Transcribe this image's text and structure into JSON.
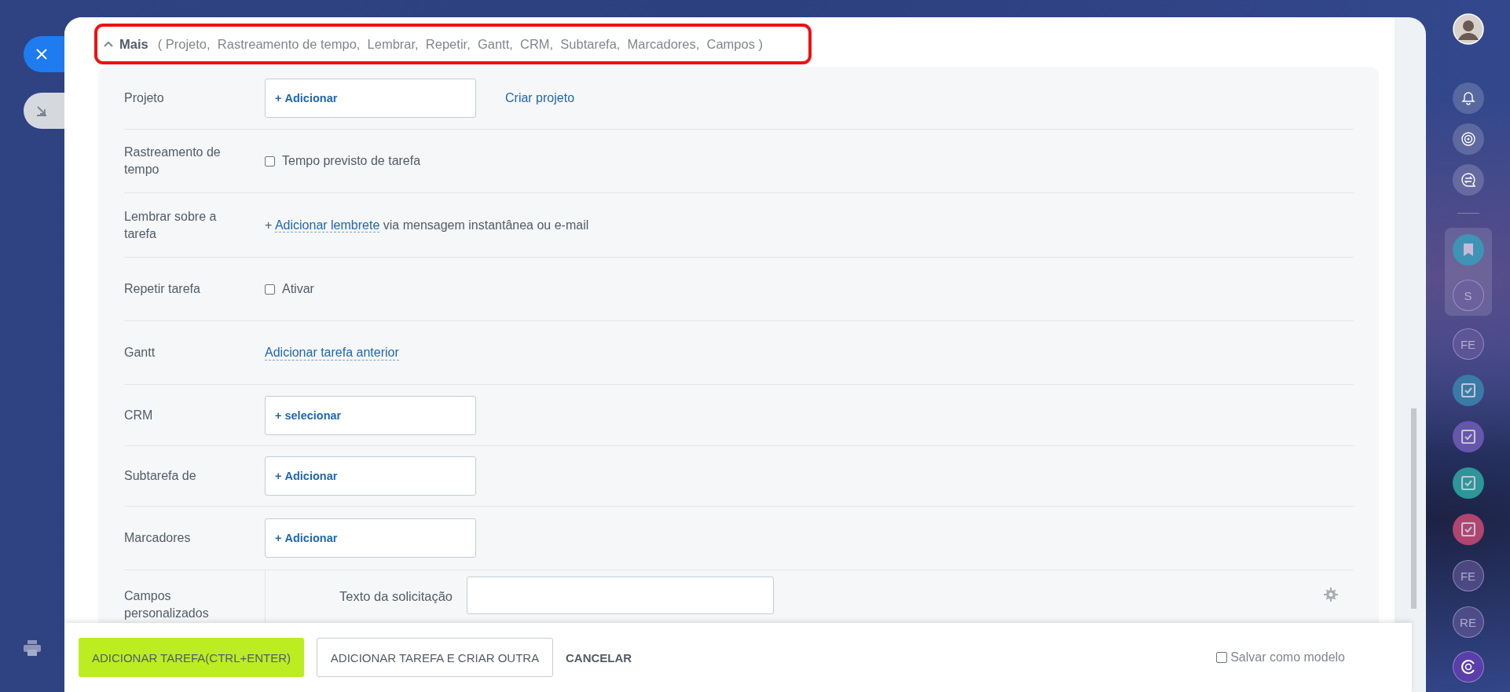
{
  "more": {
    "expanded": true,
    "title": "Mais",
    "summary": "( Projeto,  Rastreamento de tempo,  Lembrar,  Repetir,  Gantt,  CRM,  Subtarefa,  Marcadores,  Campos )"
  },
  "fields": [
    {
      "kind": "picker",
      "label": "Projeto",
      "plus": "+",
      "button": "Adicionar",
      "link": "Criar projeto"
    },
    {
      "kind": "checkbox",
      "label": "Rastreamento de tempo",
      "option": "Tempo previsto de tarefa",
      "checked": false
    },
    {
      "kind": "reminder",
      "label": "Lembrar sobre a tarefa",
      "plus": "+",
      "link": "Adicionar lembrete",
      "rest": "via mensagem instantânea ou e-mail"
    },
    {
      "kind": "checkbox",
      "label": "Repetir tarefa",
      "option": "Ativar",
      "checked": false
    },
    {
      "kind": "link",
      "label": "Gantt",
      "link": "Adicionar tarefa anterior"
    },
    {
      "kind": "picker",
      "label": "CRM",
      "plus": "+",
      "button": "selecionar"
    },
    {
      "kind": "picker",
      "label": "Subtarefa de",
      "plus": "+",
      "button": "Adicionar"
    },
    {
      "kind": "picker",
      "label": "Marcadores",
      "plus": "+",
      "button": "Adicionar"
    },
    {
      "kind": "custom",
      "label": "Campos personalizados",
      "field_label": "Texto da solicitação"
    }
  ],
  "footer": {
    "primary": "ADICIONAR TAREFA(CTRL+ENTER)",
    "secondary": "ADICIONAR TAREFA E CRIAR OUTRA",
    "cancel": "CANCELAR",
    "save_template": {
      "label": "Salvar como modelo",
      "checked": false
    }
  },
  "right_bar": {
    "chats": [
      {
        "kind": "bookmark",
        "color": "#3f93b5",
        "pinned": true
      },
      {
        "kind": "initials",
        "text": "S",
        "pinned": true
      },
      {
        "kind": "initials",
        "text": "FE",
        "pinned": false
      },
      {
        "kind": "task",
        "color": "#3a7aa6",
        "pinned": false
      },
      {
        "kind": "task",
        "color": "#6656ac",
        "pinned": false
      },
      {
        "kind": "task",
        "color": "#2c9699",
        "pinned": false
      },
      {
        "kind": "task",
        "color": "#b0456f",
        "pinned": false
      },
      {
        "kind": "initials",
        "text": "FE",
        "pinned": false
      },
      {
        "kind": "initials",
        "text": "RE",
        "pinned": false
      }
    ]
  }
}
